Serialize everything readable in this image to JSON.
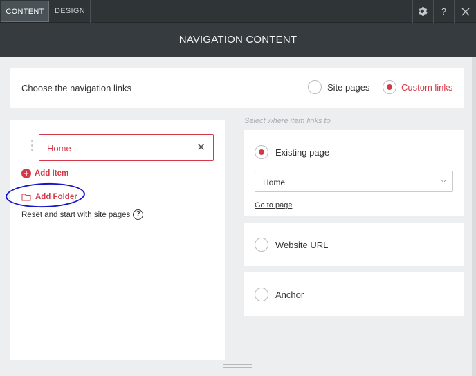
{
  "tabs": [
    {
      "label": "CONTENT",
      "active": true
    },
    {
      "label": "DESIGN",
      "active": false
    }
  ],
  "topbar": {
    "settings_icon": "gear-icon",
    "help_label": "?",
    "close_icon": "close-icon"
  },
  "header": {
    "title": "NAVIGATION CONTENT"
  },
  "choose": {
    "label": "Choose the navigation links",
    "options": [
      {
        "label": "Site pages",
        "selected": false
      },
      {
        "label": "Custom links",
        "selected": true
      }
    ]
  },
  "links": {
    "items": [
      {
        "label": "Home"
      }
    ],
    "add_item": "Add Item",
    "add_folder": "Add Folder",
    "reset": "Reset and start with site pages",
    "help_symbol": "?"
  },
  "link_target": {
    "hint": "Select where item links to",
    "options": [
      {
        "label": "Existing page",
        "selected": true
      },
      {
        "label": "Website URL",
        "selected": false
      },
      {
        "label": "Anchor",
        "selected": false
      }
    ],
    "page_select": {
      "value": "Home"
    },
    "goto_page": "Go to page"
  },
  "colors": {
    "accent": "#d4394a",
    "topbar": "#2f3437",
    "header": "#353b3e",
    "annotation": "#1515c8"
  }
}
